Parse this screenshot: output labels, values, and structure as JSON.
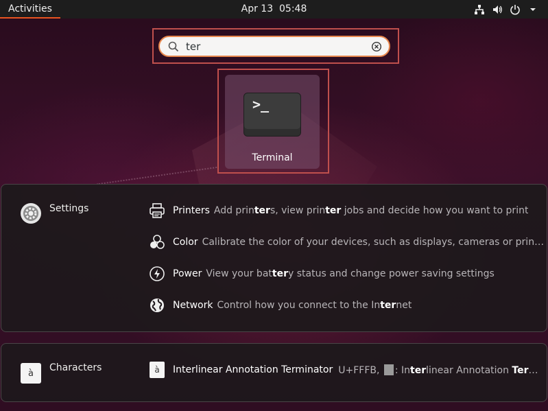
{
  "topbar": {
    "activities": "Activities",
    "date": "Apr 13",
    "time": "05:48"
  },
  "search": {
    "value": "ter",
    "clear_icon": "clear-icon"
  },
  "app_results": [
    {
      "label": "Terminal",
      "icon": "terminal-icon",
      "prompt": ">_"
    }
  ],
  "providers": {
    "settings": {
      "name": "Settings",
      "items": [
        {
          "title": "Printers",
          "desc_parts": [
            "Add prin",
            "ter",
            "s, view prin",
            "ter",
            " jobs and decide how you want to print"
          ]
        },
        {
          "title": "Color",
          "desc_parts": [
            "Calibrate the color of your devices, such as displays, cameras or print",
            "…"
          ]
        },
        {
          "title": "Power",
          "desc_parts": [
            "View your bat",
            "ter",
            "y status and change power saving settings"
          ]
        },
        {
          "title": "Network",
          "desc_parts": [
            "Control how you connect to the In",
            "ter",
            "net"
          ]
        }
      ]
    },
    "characters": {
      "name": "Characters",
      "glyph": "à",
      "item": {
        "title": "Interlinear Annotation Terminator",
        "desc_prefix": "U+FFFB, ",
        "desc_parts": [
          ": In",
          "ter",
          "linear Annotation ",
          "Term",
          "…"
        ]
      }
    }
  }
}
